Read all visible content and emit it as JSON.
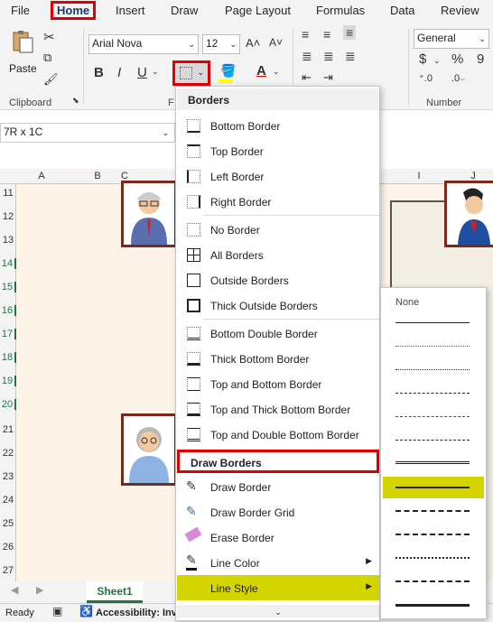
{
  "tabs": {
    "file": "File",
    "home": "Home",
    "insert": "Insert",
    "draw": "Draw",
    "page_layout": "Page Layout",
    "formulas": "Formulas",
    "data": "Data",
    "review": "Review"
  },
  "ribbon": {
    "paste": "Paste",
    "clipboard": "Clipboard",
    "font_name": "Arial Nova",
    "font_size": "12",
    "font_group_letter": "F",
    "number_format": "General",
    "number": "Number",
    "bold": "B",
    "italic": "I",
    "underline": "U",
    "currency": "$",
    "percent": "%",
    "comma": "9"
  },
  "namebox": {
    "value": "7R x 1C"
  },
  "columns": [
    "A",
    "B",
    "C",
    "I",
    "J"
  ],
  "rows": [
    "11",
    "12",
    "13",
    "14",
    "15",
    "16",
    "17",
    "18",
    "19",
    "20",
    "21",
    "22",
    "23",
    "24",
    "25",
    "26",
    "27"
  ],
  "menu": {
    "borders_header": "Borders",
    "items": [
      "Bottom Border",
      "Top Border",
      "Left Border",
      "Right Border",
      "No Border",
      "All Borders",
      "Outside Borders",
      "Thick Outside Borders",
      "Bottom Double Border",
      "Thick Bottom Border",
      "Top and Bottom Border",
      "Top and Thick Bottom Border",
      "Top and Double Bottom Border"
    ],
    "draw_header": "Draw Borders",
    "draw_items": [
      "Draw Border",
      "Draw Border Grid",
      "Erase Border",
      "Line Color",
      "Line Style"
    ]
  },
  "line_style": {
    "none": "None",
    "selected_index": 8
  },
  "sheet": {
    "tab": "Sheet1"
  },
  "status": {
    "ready": "Ready",
    "accessibility": "Accessibility: Inv"
  },
  "colors": {
    "highlight": "#d4d400",
    "red_outline": "#e00000",
    "excel_green": "#217346",
    "grid_bg": "#fdf3e7"
  }
}
